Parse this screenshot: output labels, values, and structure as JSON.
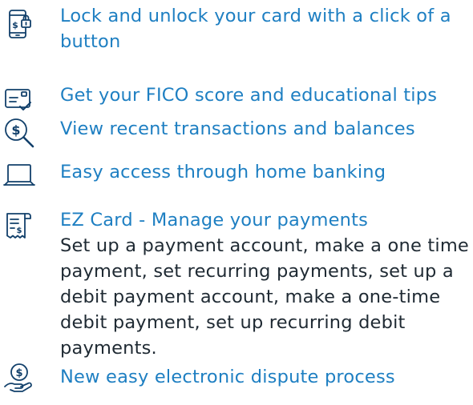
{
  "colors": {
    "accent": "#1E7FC2",
    "icon": "#12406B",
    "body_text": "#1F2A33",
    "background": "#FFFFFF"
  },
  "features": [
    {
      "icon": "phone-lock-icon",
      "title": "Lock and unlock your card with a click of a button"
    },
    {
      "icon": "credit-score-card-icon",
      "title": "Get your FICO score and educational tips"
    },
    {
      "icon": "magnifier-dollar-icon",
      "title": "View recent transactions and balances"
    },
    {
      "icon": "laptop-icon",
      "title": "Easy access through home banking"
    },
    {
      "icon": "receipt-dollar-icon",
      "title": "EZ Card - Manage your payments",
      "description": "Set up a payment account, make a one time payment, set recurring payments, set up a debit payment account, make a one-time debit payment, set up recurring debit payments."
    },
    {
      "icon": "hand-dollar-icon",
      "title": "New easy electronic dispute process"
    }
  ]
}
